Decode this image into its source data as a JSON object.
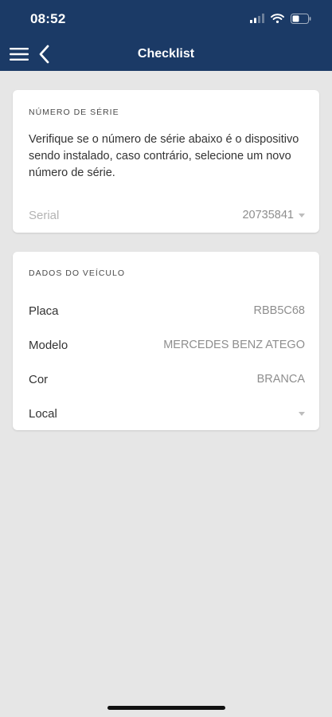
{
  "status_bar": {
    "time": "08:52"
  },
  "header": {
    "title": "Checklist"
  },
  "serial_card": {
    "heading": "NÚMERO DE SÉRIE",
    "description": "Verifique se o número de série abaixo é o dispositivo sendo instalado, caso contrário, selecione um novo número de série.",
    "serial_label": "Serial",
    "serial_value": "20735841"
  },
  "vehicle_card": {
    "heading": "DADOS DO VEÍCULO",
    "rows": [
      {
        "label": "Placa",
        "value": "RBB5C68"
      },
      {
        "label": "Modelo",
        "value": "MERCEDES BENZ ATEGO"
      },
      {
        "label": "Cor",
        "value": "BRANCA"
      },
      {
        "label": "Local",
        "value": ""
      }
    ]
  },
  "colors": {
    "header_bg": "#1b3a66",
    "page_bg": "#e6e6e6",
    "card_bg": "#ffffff"
  },
  "icons": [
    "cellular-signal-icon",
    "wifi-icon",
    "battery-icon",
    "hamburger-menu-icon",
    "back-arrow-icon",
    "dropdown-caret-icon"
  ]
}
